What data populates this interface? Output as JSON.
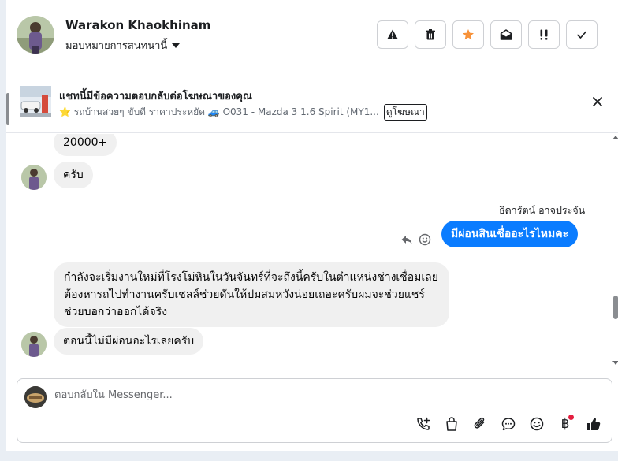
{
  "header": {
    "name": "Warakon Khaokhinam",
    "assign_label": "มอบหมายการสนทนานี้",
    "actions": [
      "warning-icon",
      "trash-icon",
      "star-icon",
      "envelope-open-icon",
      "follow-up-icon",
      "check-icon"
    ],
    "star_color": "#f7923a"
  },
  "ad": {
    "title": "แชทนี้มีข้อความตอบกลับต่อโฆษณาของคุณ",
    "subtitle": "⭐ รถบ้านสวยๆ ขับดี ราคาประหยัด 🚙 O031 - Mazda 3 1.6 Spirit (MY1...",
    "link_label": "ดูโฆษณา"
  },
  "messages": {
    "m1": "20000+",
    "m2": "ครับ",
    "sender_name": "ธิดารัตน์ อาจประจัน",
    "m3": "มีผ่อนสินเชื่ออะไรไหมคะ",
    "m4": "กำลังจะเริ่มงานใหม่ที่โรงโม่หินในวันจันทร์ที่จะถึงนี้ครับในตำแหน่งช่างเชื่อมเลยต้องหารถไปทำงานครับเชลล์ช่วยดันให้ปมสมหวังน่อยเถอะครับผมจะช่วยแชร์ช่วยบอกว่าออกได้จริง",
    "m5": "ตอนนี้ไม่มีผ่อนอะไรเลยครับ",
    "outgoing_color": "#0a7cff"
  },
  "composer": {
    "placeholder": "ตอบกลับใน Messenger...",
    "tools": [
      "call-add-icon",
      "shopping-bag-icon",
      "paperclip-icon",
      "saved-reply-icon",
      "emoji-icon",
      "baht-icon",
      "thumbs-up-icon"
    ],
    "baht_symbol": "฿"
  }
}
